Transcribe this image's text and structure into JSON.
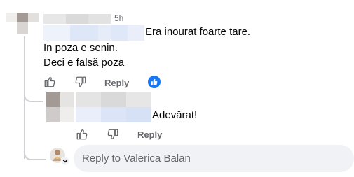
{
  "comment": {
    "timestamp": "5h",
    "text_inline": "Era inourat foarte tare.",
    "text_line2": "In poza e senin.",
    "text_line3": "Deci e falsă poza",
    "reply_label": "Reply",
    "reaction": "like-icon"
  },
  "reply": {
    "text": "Adevărat!",
    "reply_label": "Reply"
  },
  "composer": {
    "placeholder": "Reply to Valerica Balan"
  },
  "colors": {
    "like_blue": "#1877f2",
    "thread_line": "#ced0d4",
    "composer_bg": "#f0f2f5",
    "muted_text": "#65676b"
  }
}
